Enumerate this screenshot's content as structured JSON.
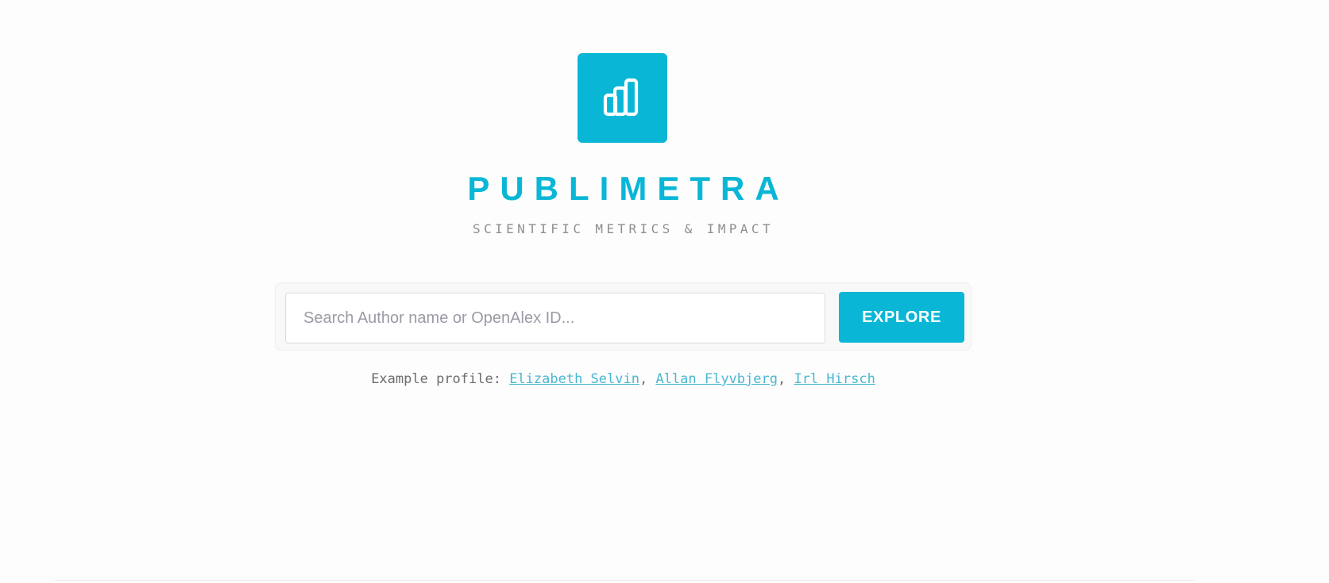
{
  "brand": {
    "logo_icon": "bar-chart-icon",
    "title": "PUBLIMETRA",
    "subtitle": "SCIENTIFIC METRICS & IMPACT"
  },
  "search": {
    "placeholder": "Search Author name or OpenAlex ID...",
    "value": "",
    "button_label": "EXPLORE"
  },
  "examples": {
    "prefix": "Example profile: ",
    "separator": ", ",
    "profiles": [
      "Elizabeth Selvin",
      "Allan Flyvbjerg",
      "Irl Hirsch"
    ]
  },
  "colors": {
    "accent": "#09b6d6",
    "link": "#4ab7d0",
    "subtitle": "#8e8e8e",
    "background": "#fdfdfd"
  }
}
